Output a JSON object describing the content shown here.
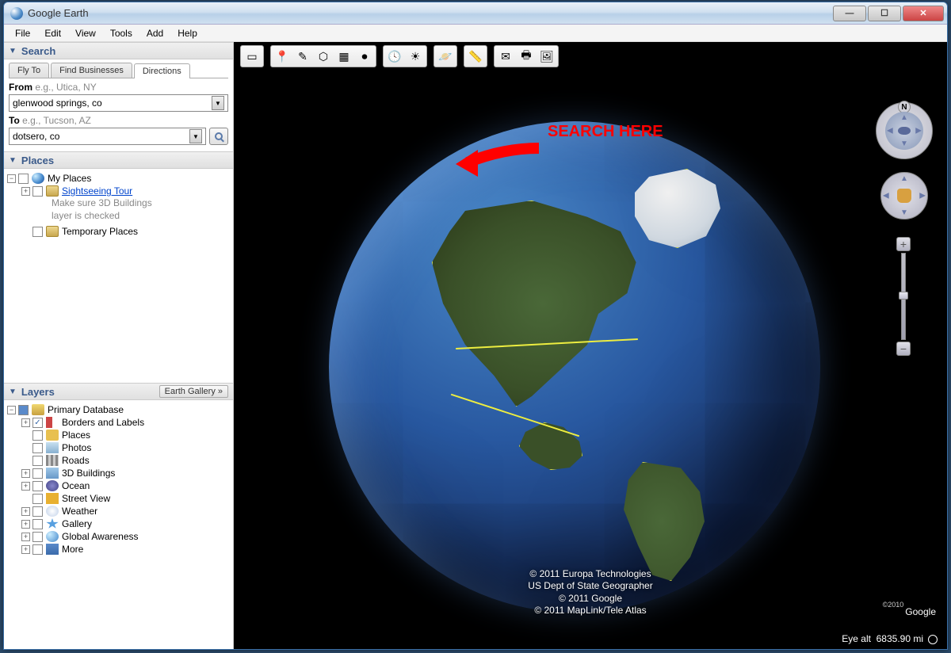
{
  "window": {
    "title": "Google Earth"
  },
  "menubar": [
    "File",
    "Edit",
    "View",
    "Tools",
    "Add",
    "Help"
  ],
  "search": {
    "header": "Search",
    "tabs": [
      "Fly To",
      "Find Businesses",
      "Directions"
    ],
    "active_tab": 2,
    "from_label_prefix": "From",
    "from_label_hint": " e.g., Utica, NY",
    "from_value": "glenwood springs, co",
    "to_label_prefix": "To",
    "to_label_hint": " e.g., Tucson, AZ",
    "to_value": "dotsero, co"
  },
  "annotation": {
    "text": "SEARCH HERE"
  },
  "places": {
    "header": "Places",
    "my_places": "My Places",
    "sightseeing": "Sightseeing Tour",
    "sightseeing_hint1": "Make sure 3D Buildings",
    "sightseeing_hint2": "layer is checked",
    "temp": "Temporary Places"
  },
  "layers": {
    "header": "Layers",
    "gallery_btn": "Earth Gallery »",
    "root": "Primary Database",
    "items": [
      {
        "label": "Borders and Labels",
        "checked": true,
        "expandable": true,
        "icon": "flag"
      },
      {
        "label": "Places",
        "checked": false,
        "expandable": false,
        "icon": "place"
      },
      {
        "label": "Photos",
        "checked": false,
        "expandable": false,
        "icon": "photo"
      },
      {
        "label": "Roads",
        "checked": false,
        "expandable": false,
        "icon": "road"
      },
      {
        "label": "3D Buildings",
        "checked": false,
        "expandable": true,
        "icon": "building"
      },
      {
        "label": "Ocean",
        "checked": false,
        "expandable": true,
        "icon": "ocean"
      },
      {
        "label": "Street View",
        "checked": false,
        "expandable": false,
        "icon": "pegman"
      },
      {
        "label": "Weather",
        "checked": false,
        "expandable": true,
        "icon": "weather"
      },
      {
        "label": "Gallery",
        "checked": false,
        "expandable": true,
        "icon": "star"
      },
      {
        "label": "Global Awareness",
        "checked": false,
        "expandable": true,
        "icon": "globe"
      },
      {
        "label": "More",
        "checked": false,
        "expandable": true,
        "icon": "more"
      }
    ]
  },
  "attribution": {
    "line1": "© 2011 Europa Technologies",
    "line2": "US Dept of State Geographer",
    "line3": "© 2011 Google",
    "line4": "© 2011 MapLink/Tele Atlas"
  },
  "logo": {
    "year": "©2010",
    "brand": "Google"
  },
  "status": {
    "eye_alt_label": "Eye alt",
    "eye_alt_value": "6835.90 mi"
  },
  "toolbar_groups": [
    [
      "panel"
    ],
    [
      "pin",
      "path",
      "polygon",
      "overlay",
      "record"
    ],
    [
      "clock",
      "sun"
    ],
    [
      "planet"
    ],
    [
      "ruler"
    ],
    [
      "email",
      "print",
      "gallery"
    ]
  ]
}
